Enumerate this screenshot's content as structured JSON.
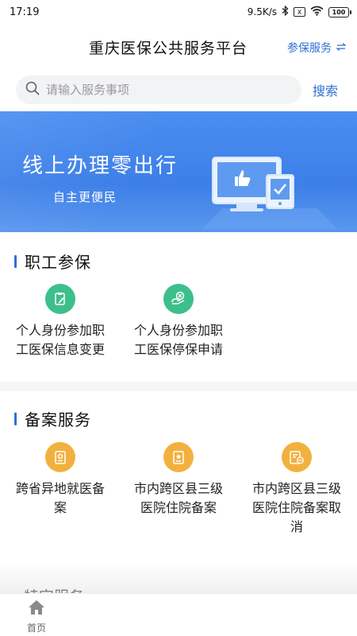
{
  "status": {
    "time": "17:19",
    "net_speed": "9.5K/s",
    "bluetooth_icon": "bluetooth-icon",
    "sim_label": "X",
    "wifi_icon": "wifi-icon",
    "battery": "100"
  },
  "header": {
    "title": "重庆医保公共服务平台",
    "link_label": "参保服务",
    "link_icon": "switch-arrows-icon"
  },
  "search": {
    "placeholder": "请输入服务事项",
    "button_label": "搜索"
  },
  "banner": {
    "title": "线上办理零出行",
    "subtitle": "自主更便民"
  },
  "sections": [
    {
      "title": "职工参保",
      "items": [
        {
          "label_line1": "个人身份参加职",
          "label_line2": "工医保信息变更",
          "icon": "edit-doc-icon",
          "color": "#3dbf8c"
        },
        {
          "label_line1": "个人身份参加职",
          "label_line2": "工医保停保申请",
          "icon": "stop-cancel-icon",
          "color": "#3dbf8c"
        }
      ]
    },
    {
      "title": "备案服务",
      "items": [
        {
          "label_line1": "跨省异地就医备",
          "label_line2": "案",
          "icon": "location-doc-icon",
          "color": "#f2b13f"
        },
        {
          "label_line1": "市内跨区县三级",
          "label_line2": "医院住院备案",
          "icon": "star-doc-icon",
          "color": "#f2b13f"
        },
        {
          "label_line1": "市内跨区县三级",
          "label_line2": "医院住院备案取",
          "label_line3": "消",
          "icon": "doc-cancel-icon",
          "color": "#f2b13f"
        }
      ]
    }
  ],
  "partial_section": {
    "title": "特定服务"
  },
  "tabbar": {
    "home_label": "首页",
    "home_icon": "home-icon"
  },
  "colors": {
    "accent": "#2f6fd6",
    "banner": "#4a8ef0",
    "green": "#3dbf8c",
    "gold": "#f2b13f"
  }
}
